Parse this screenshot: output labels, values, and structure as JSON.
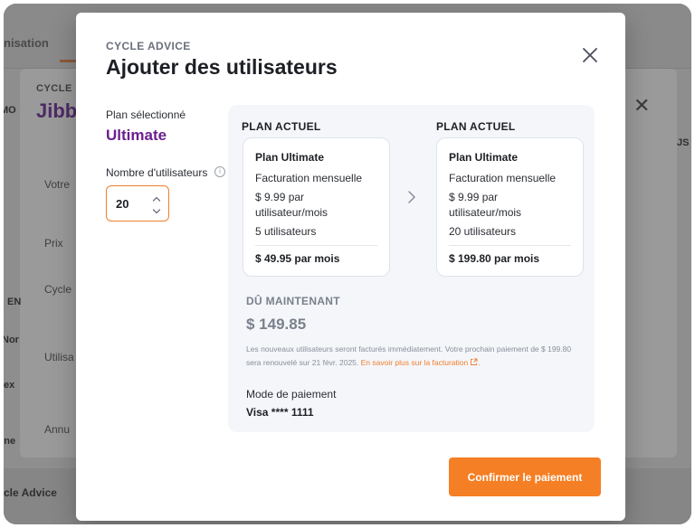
{
  "background": {
    "tab_label": "nisation",
    "card_eyebrow": "CYCLE",
    "card_title": "Jibb",
    "left_edge_label": "MO",
    "right_edge_label": "JS",
    "rows": [
      "Votre",
      "Prix",
      "Cycle",
      "Utilisa",
      "Annu"
    ],
    "side_texts": [
      "EN",
      "Nor",
      "ex",
      "rne"
    ],
    "footer_text": "cle Advice"
  },
  "modal": {
    "eyebrow": "CYCLE ADVICE",
    "title": "Ajouter des utilisateurs",
    "close_icon": "close-icon"
  },
  "left": {
    "plan_label": "Plan sélectionné",
    "plan_name": "Ultimate",
    "users_label": "Nombre d'utilisateurs",
    "users_value": "20"
  },
  "current_plan": {
    "heading": "PLAN ACTUEL",
    "title": "Plan Ultimate",
    "billing": "Facturation mensuelle",
    "price_line1": "$ 9.99 par",
    "price_line2": "utilisateur/mois",
    "users": "5 utilisateurs",
    "total": "$ 49.95 par mois"
  },
  "new_plan": {
    "heading": "PLAN ACTUEL",
    "title": "Plan Ultimate",
    "billing": "Facturation mensuelle",
    "price_line1": "$ 9.99 par",
    "price_line2": "utilisateur/mois",
    "users": "20 utilisateurs",
    "total": "$ 199.80 par mois"
  },
  "due": {
    "label": "DÛ MAINTENANT",
    "amount": "$ 149.85",
    "note_text": "Les nouveaux utilisateurs seront facturés immédiatement. Votre prochain paiement de $ 199.80 sera renouvelé sur 21 févr. 2025. ",
    "note_link": "En savoir plus sur la facturation",
    "note_end": "."
  },
  "payment": {
    "label": "Mode de paiement",
    "value": "Visa **** 1111"
  },
  "actions": {
    "confirm_label": "Confirmer le paiement"
  },
  "colors": {
    "accent": "#f57f24",
    "plan_purple": "#6b1e8f"
  }
}
